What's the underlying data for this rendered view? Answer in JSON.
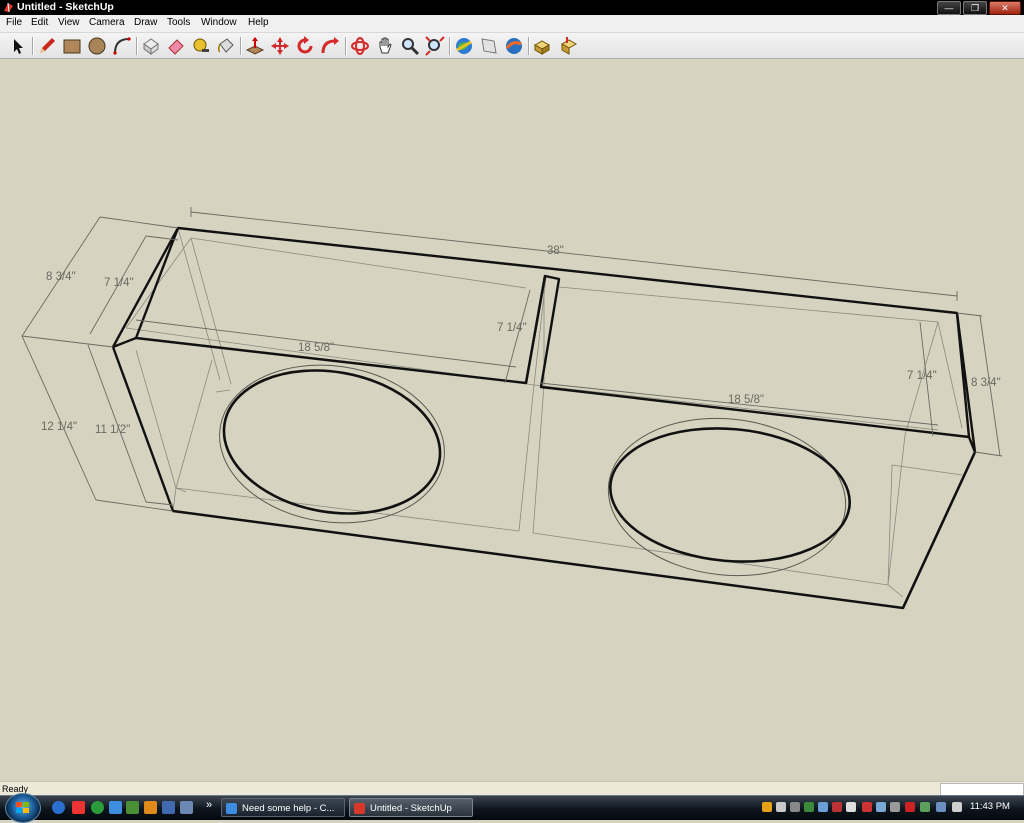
{
  "window": {
    "title": "Untitled - SketchUp"
  },
  "menu": [
    "File",
    "Edit",
    "View",
    "Camera",
    "Draw",
    "Tools",
    "Window",
    "Help"
  ],
  "toolbar": {
    "tools": [
      "select-tool",
      "pencil-tool",
      "rectangle-tool",
      "circle-tool",
      "arc-tool",
      "make-component-tool",
      "eraser-tool",
      "tape-measure-tool",
      "paint-bucket-tool",
      "push-pull-tool",
      "move-tool",
      "rotate-tool",
      "follow-me-tool",
      "orbit-tool",
      "pan-tool",
      "zoom-tool",
      "zoom-extents-tool",
      "get-models-tool",
      "share-model-tool",
      "google-earth-tool",
      "components-tool",
      "3d-warehouse-tool"
    ]
  },
  "drawing": {
    "dimensions": {
      "overall_length": "38\"",
      "outer_depth_left": "8 3/4\"",
      "inner_depth_left": "7 1/4\"",
      "outer_height": "12 1/4\"",
      "inner_height": "11 1/2\"",
      "chamber_left_width": "18 5/8\"",
      "divider_depth": "7 1/4\"",
      "chamber_right_width": "18 5/8\"",
      "inner_depth_right": "7 1/4\"",
      "outer_depth_right": "8 3/4\""
    }
  },
  "statusbar": {
    "text": "Ready"
  },
  "taskbar": {
    "windows": [
      {
        "label": "Need some help - C...",
        "active": false
      },
      {
        "label": "Untitled - SketchUp",
        "active": true
      }
    ],
    "clock": "11:43 PM",
    "overflow": "»"
  },
  "colors": {
    "viewport": "#d6d3c0",
    "edge": "#111111",
    "dimension": "#6a6a62"
  }
}
